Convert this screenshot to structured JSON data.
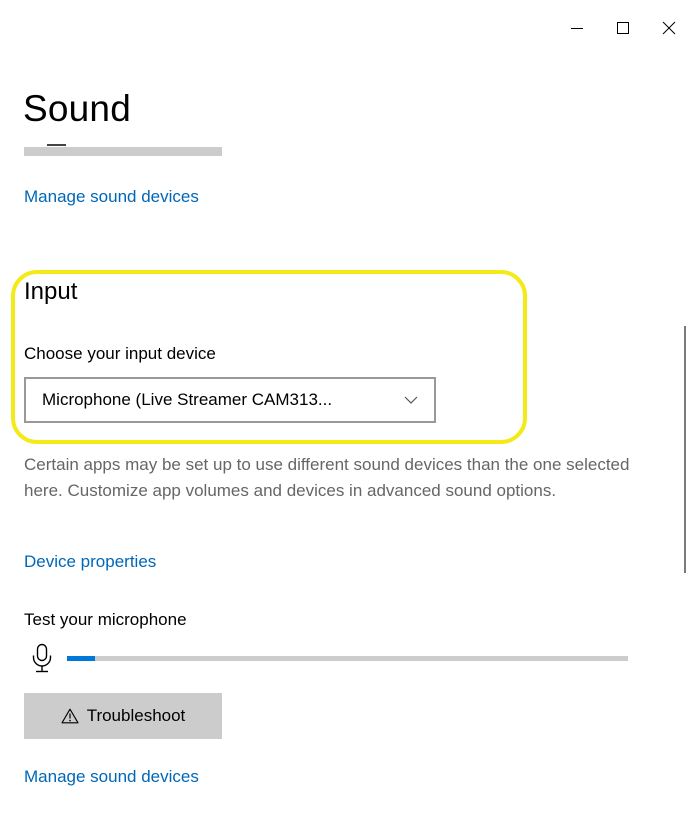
{
  "window": {
    "minimize_icon": "minimize-icon",
    "maximize_icon": "maximize-icon",
    "close_icon": "close-icon"
  },
  "page": {
    "title": "Sound"
  },
  "output": {
    "manage_link": "Manage sound devices"
  },
  "input": {
    "heading": "Input",
    "device_label": "Choose your input device",
    "selected_device": "Microphone (Live Streamer CAM313...",
    "description": "Certain apps may be set up to use different sound devices than the one selected here. Customize app volumes and devices in advanced sound options.",
    "device_properties_link": "Device properties",
    "test_label": "Test your microphone",
    "mic_level": 0.05,
    "troubleshoot_label": "Troubleshoot",
    "manage_link": "Manage sound devices"
  },
  "colors": {
    "accent": "#0078d7",
    "link": "#0067b8",
    "highlight": "#f4ea1a"
  }
}
